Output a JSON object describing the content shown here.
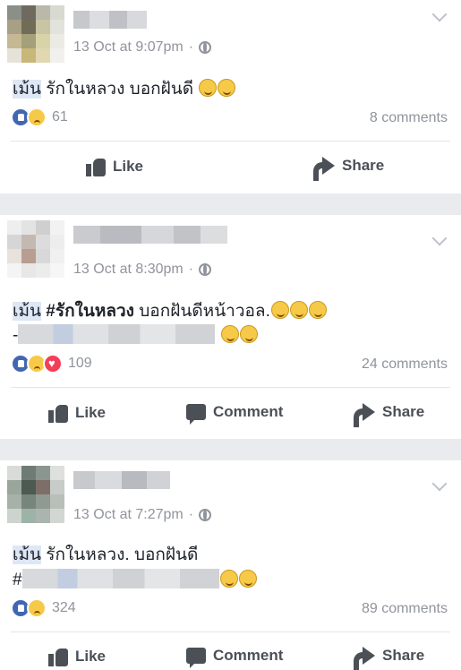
{
  "posts": [
    {
      "timestamp": "13 Oct at 9:07pm",
      "separator": "·",
      "privacy_icon": "globe-icon",
      "text_tag": "เม้น",
      "text_body": " รักในหลวง บอกฝันดี",
      "reaction_count": "61",
      "comments": "8 comments",
      "reactions": [
        "like",
        "sad"
      ],
      "actions": {
        "like": "Like",
        "share": "Share"
      }
    },
    {
      "timestamp": "13 Oct at 8:30pm",
      "separator": "·",
      "privacy_icon": "globe-icon",
      "text_tag": "เม้น",
      "text_hashtag": "#รักในหลวง",
      "text_body": " บอกฝันดีหน้าวอล.",
      "line2_prefix": "-",
      "reaction_count": "109",
      "comments": "24 comments",
      "reactions": [
        "like",
        "sad",
        "love"
      ],
      "actions": {
        "like": "Like",
        "comment": "Comment",
        "share": "Share"
      }
    },
    {
      "timestamp": "13 Oct at 7:27pm",
      "separator": "·",
      "privacy_icon": "globe-icon",
      "text_tag": "เม้น",
      "text_body": " รักในหลวง. บอกฝันดี",
      "line2_prefix": "#",
      "reaction_count": "324",
      "comments": "89 comments",
      "reactions": [
        "like",
        "sad"
      ],
      "actions": {
        "like": "Like",
        "comment": "Comment",
        "share": "Share"
      }
    }
  ],
  "colors": {
    "page_bg": "#e9ebee",
    "like_blue": "#4267b2",
    "meta_gray": "#90949c",
    "action_gray": "#4b4f56"
  }
}
